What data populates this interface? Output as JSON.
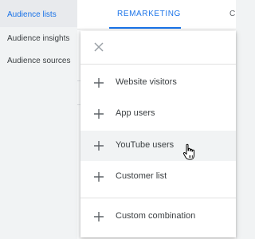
{
  "sidebar": {
    "items": [
      {
        "label": "Audience lists",
        "active": true
      },
      {
        "label": "Audience insights",
        "active": false
      },
      {
        "label": "Audience sources",
        "active": false
      }
    ]
  },
  "tabs": [
    {
      "label": "REMARKETING",
      "active": true
    },
    {
      "label": "CUSTOM",
      "active": false
    }
  ],
  "menu": {
    "close_icon": "close-icon",
    "items": [
      {
        "label": "Website visitors",
        "icon": "plus-icon"
      },
      {
        "label": "App users",
        "icon": "plus-icon"
      },
      {
        "label": "YouTube users",
        "icon": "plus-icon",
        "hovered": true
      },
      {
        "label": "Customer list",
        "icon": "plus-icon"
      },
      {
        "label": "Custom combination",
        "icon": "plus-icon"
      }
    ]
  },
  "colors": {
    "accent": "#1a73e8",
    "text": "#3c4043",
    "sidebar_bg": "#f1f3f4",
    "hover_bg": "#f1f3f4"
  },
  "cursor": "hand-pointer-icon"
}
